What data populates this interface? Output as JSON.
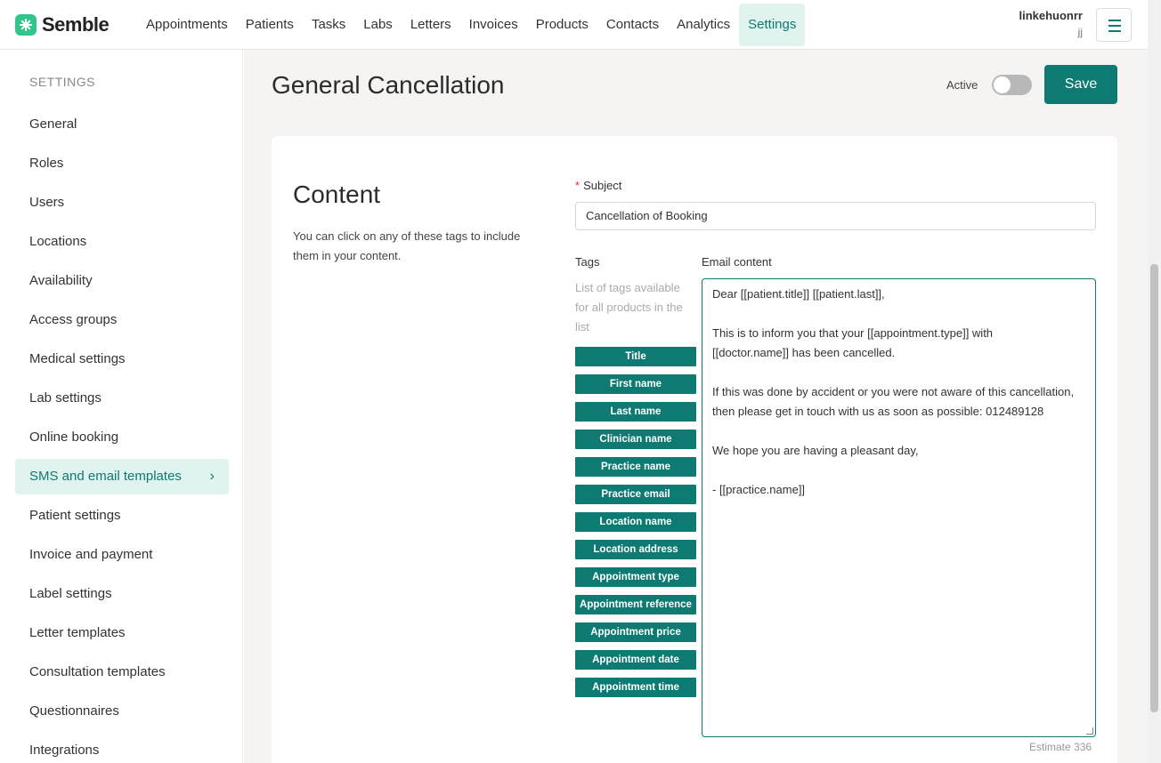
{
  "app": {
    "logo_text": "Semble"
  },
  "nav": {
    "items": [
      "Appointments",
      "Patients",
      "Tasks",
      "Labs",
      "Letters",
      "Invoices",
      "Products",
      "Contacts",
      "Analytics",
      "Settings"
    ],
    "active": "Settings"
  },
  "user": {
    "name": "linkehuonrr",
    "sub": "jj"
  },
  "sidebar": {
    "title": "SETTINGS",
    "items": [
      "General",
      "Roles",
      "Users",
      "Locations",
      "Availability",
      "Access groups",
      "Medical settings",
      "Lab settings",
      "Online booking",
      "SMS and email templates",
      "Patient settings",
      "Invoice and payment",
      "Label settings",
      "Letter templates",
      "Consultation templates",
      "Questionnaires",
      "Integrations"
    ],
    "active": "SMS and email templates"
  },
  "page": {
    "title": "General Cancellation",
    "active_label": "Active",
    "active_on": false,
    "save_label": "Save"
  },
  "content": {
    "title": "Content",
    "description": "You can click on any of these tags to include them in your content.",
    "subject_label": "Subject",
    "subject_value": "Cancellation of Booking",
    "tags_label": "Tags",
    "tags_hint": "List of tags available for all products in the list",
    "tags": [
      "Title",
      "First name",
      "Last name",
      "Clinician name",
      "Practice name",
      "Practice email",
      "Location name",
      "Location address",
      "Appointment type",
      "Appointment reference",
      "Appointment price",
      "Appointment date",
      "Appointment time"
    ],
    "email_label": "Email content",
    "email_lines": [
      "Dear [[patient.title]] [[patient.last]],",
      "",
      "This is to inform you that your [[appointment.type]] with",
      "[[doctor.name]] has been cancelled.",
      "",
      "If this was done by accident or you were not aware of this cancellation,",
      "then please get in touch with us as soon as possible: 012489128",
      "",
      "We hope you are having a pleasant day,",
      "",
      "- [[practice.name]]"
    ],
    "estimate": "Estimate 336"
  },
  "colors": {
    "accent": "#0e7a72",
    "accent_light": "#e0f3ef",
    "brand": "#31c48d"
  }
}
